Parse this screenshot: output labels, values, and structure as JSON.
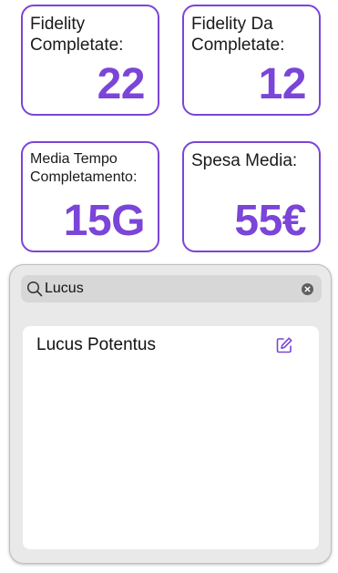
{
  "stats": [
    {
      "label_line1": "Fidelity",
      "label_line2": "Completate:",
      "value": "22"
    },
    {
      "label_line1": "Fidelity Da",
      "label_line2": "Completate:",
      "value": "12"
    },
    {
      "label_line1": "Media Tempo",
      "label_line2": "Completamento:",
      "value": "15G"
    },
    {
      "label_line1": "Spesa Media:",
      "label_line2": "",
      "value": "55€"
    }
  ],
  "search": {
    "value": "Lucus",
    "search_icon": "search-icon",
    "clear_icon": "clear-icon"
  },
  "results": [
    {
      "name": "Lucus Potentus",
      "action_icon": "edit-icon"
    }
  ],
  "colors": {
    "accent": "#7b45d8",
    "panel_bg": "#e9e9e9",
    "search_bg": "#d7d7d7"
  }
}
